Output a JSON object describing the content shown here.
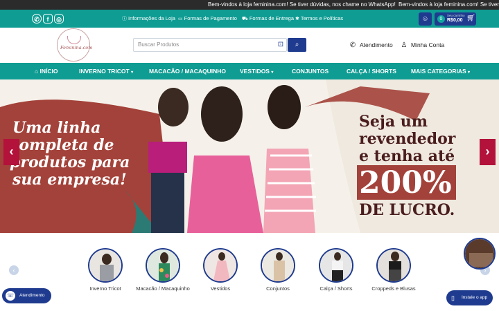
{
  "ticker": {
    "message_1": "Bem-vindos à loja feminina.com! Se tiver dúvidas, nos chame no WhatsApp!",
    "message_2": "Bem-vindos à loja feminina.com! Se tiver dúvidas, nos chame no WhatsApp!"
  },
  "topbar": {
    "links": [
      {
        "icon": "info-icon",
        "label": "Informações da Loja"
      },
      {
        "icon": "credit-card-icon",
        "label": "Formas de Pagamento"
      },
      {
        "icon": "truck-icon",
        "label": "Formas de Entrega"
      },
      {
        "icon": "gear-icon",
        "label": "Termos e Políticas"
      }
    ],
    "cart": {
      "count": "0",
      "label": "Seu carrinho",
      "total": "R$0,00"
    }
  },
  "header": {
    "logo_text": "Feminina.com",
    "search_placeholder": "Buscar Produtos",
    "support_label": "Atendimento",
    "account_label": "Minha Conta"
  },
  "nav": {
    "items": [
      {
        "label": "INÍCIO",
        "has_dropdown": false
      },
      {
        "label": "INVERNO TRICOT",
        "has_dropdown": true
      },
      {
        "label": "MACACÃO / MACAQUINHO",
        "has_dropdown": false
      },
      {
        "label": "VESTIDOS",
        "has_dropdown": true
      },
      {
        "label": "CONJUNTOS",
        "has_dropdown": false
      },
      {
        "label": "CALÇA / SHORTS",
        "has_dropdown": false
      },
      {
        "label": "MAIS CATEGORIAS",
        "has_dropdown": true
      }
    ]
  },
  "banner": {
    "left_lines": [
      "Uma linha",
      "completa de",
      "produtos para",
      "sua empresa!"
    ],
    "right_line_1": "Seja um",
    "right_line_2": "revendedor",
    "right_line_3": "e tenha até",
    "right_percent": "200%",
    "right_profit": "DE LUCRO."
  },
  "categories": [
    {
      "label": "Inverno Tricot"
    },
    {
      "label": "Macacão / Macaquinho"
    },
    {
      "label": "Vestidos"
    },
    {
      "label": "Conjuntos"
    },
    {
      "label": "Calça / Shorts"
    },
    {
      "label": "Croppeds e Blusas"
    }
  ],
  "floating": {
    "support_label": "Atendimento",
    "install_label": "Instale o app"
  },
  "colors": {
    "teal": "#0f9c93",
    "navy": "#1f3b8f",
    "banner_red": "#a3423a",
    "slider_red": "#b3123b"
  }
}
